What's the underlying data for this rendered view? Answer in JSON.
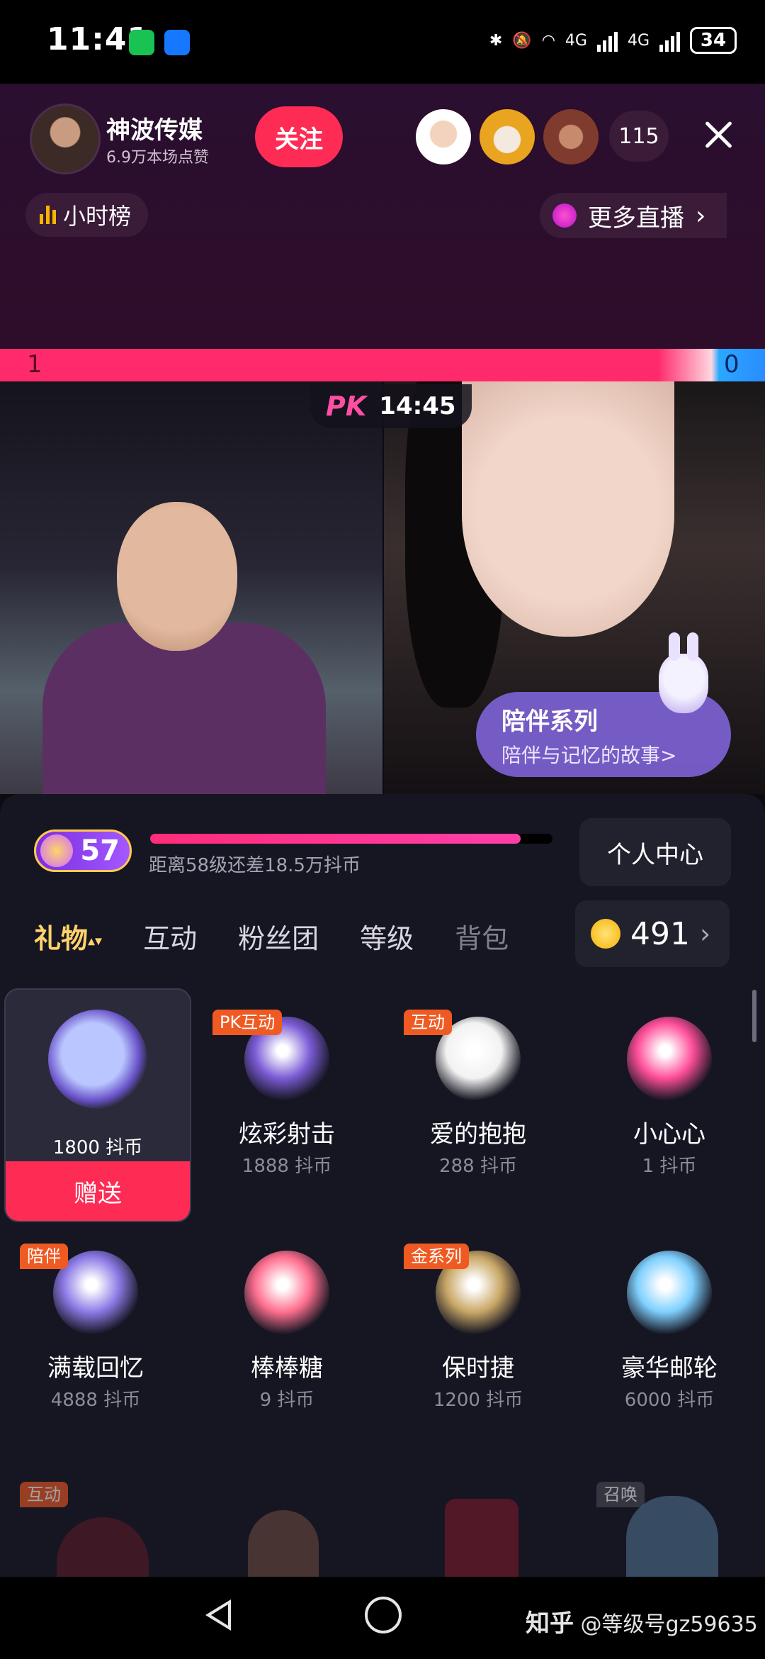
{
  "status_bar": {
    "time": "11:41",
    "network_1": "4G",
    "network_2": "4G",
    "battery": "34"
  },
  "header": {
    "host_name": "神波传媒",
    "host_likes": "6.9万本场点赞",
    "follow_label": "关注",
    "viewer_count": "115",
    "hour_rank_label": "小时榜",
    "more_live_label": "更多直播",
    "more_live_arrow": "›"
  },
  "pk": {
    "left_score": "1",
    "right_score": "0",
    "logo": "PK",
    "timer": "14:45"
  },
  "companion_banner": {
    "title": "陪伴系列",
    "subtitle": "陪伴与记忆的故事>"
  },
  "panel": {
    "level": "57",
    "level_progress": 0.92,
    "level_hint": "距离58级还差18.5万抖币",
    "personal_center": "个人中心",
    "tabs": [
      "礼物",
      "互动",
      "粉丝团",
      "等级",
      "背包"
    ],
    "tab_sort_glyph": "▴▾",
    "coin_balance": "491",
    "coin_arrow": "›",
    "send_label": "赠送",
    "selected_price": "1800 抖币"
  },
  "gifts": [
    {
      "name": "炫彩射击",
      "price": "1888 抖币",
      "tag": "PK互动",
      "color": "#7b5cd6"
    },
    {
      "name": "爱的抱抱",
      "price": "288 抖币",
      "tag": "互动",
      "color": "#f2f2f2"
    },
    {
      "name": "小心心",
      "price": "1 抖币",
      "tag": "",
      "color": "#ff4f9a"
    },
    {
      "name": "满载回忆",
      "price": "4888 抖币",
      "tag": "陪伴",
      "color": "#8d7ae6"
    },
    {
      "name": "棒棒糖",
      "price": "9 抖币",
      "tag": "",
      "color": "#ff6f8f"
    },
    {
      "name": "保时捷",
      "price": "1200 抖币",
      "tag": "金系列",
      "color": "#c9a766"
    },
    {
      "name": "豪华邮轮",
      "price": "6000 抖币",
      "tag": "",
      "color": "#7fd0ff"
    }
  ],
  "next_row_tags": {
    "first": "互动",
    "fourth": "召唤"
  },
  "watermark": {
    "brand": "知乎",
    "handle": "@等级号gz59635"
  }
}
